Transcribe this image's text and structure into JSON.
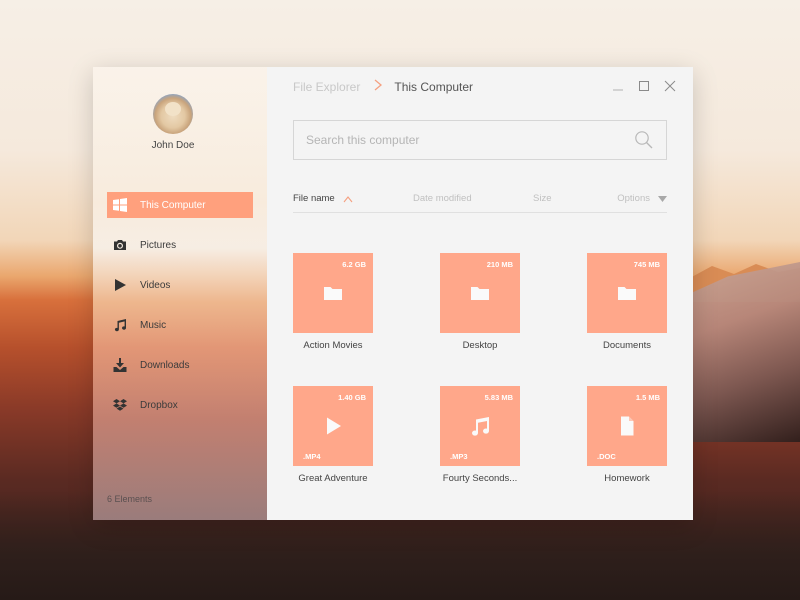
{
  "window": {
    "breadcrumb": {
      "root": "File Explorer",
      "separator": ">",
      "current": "This Computer"
    },
    "controls": [
      "minimize",
      "maximize",
      "close"
    ]
  },
  "user": {
    "name": "John Doe"
  },
  "sidebar": {
    "items": [
      {
        "label": "This Computer",
        "icon": "windows-icon",
        "active": true
      },
      {
        "label": "Pictures",
        "icon": "camera-icon",
        "active": false
      },
      {
        "label": "Videos",
        "icon": "play-icon",
        "active": false
      },
      {
        "label": "Music",
        "icon": "music-note-icon",
        "active": false
      },
      {
        "label": "Downloads",
        "icon": "download-icon",
        "active": false
      },
      {
        "label": "Dropbox",
        "icon": "dropbox-icon",
        "active": false
      }
    ],
    "footer": "6 Elements"
  },
  "search": {
    "placeholder": "Search this computer",
    "value": ""
  },
  "columns": {
    "name": "File name",
    "date": "Date modified",
    "size": "Size",
    "options": "Options"
  },
  "files": [
    {
      "name": "Action Movies",
      "size": "6.2 GB",
      "type": "folder",
      "ext": ""
    },
    {
      "name": "Desktop",
      "size": "210 MB",
      "type": "folder",
      "ext": ""
    },
    {
      "name": "Documents",
      "size": "745 MB",
      "type": "folder",
      "ext": ""
    },
    {
      "name": "Great Adventure",
      "size": "1.40 GB",
      "type": "video",
      "ext": ".MP4"
    },
    {
      "name": "Fourty Seconds...",
      "size": "5.83 MB",
      "type": "audio",
      "ext": ".MP3"
    },
    {
      "name": "Homework",
      "size": "1.5 MB",
      "type": "document",
      "ext": ".DOC"
    }
  ],
  "colors": {
    "accent": "#ffa07d",
    "tile": "#ffa78a",
    "main_bg": "#f4f4f4"
  }
}
